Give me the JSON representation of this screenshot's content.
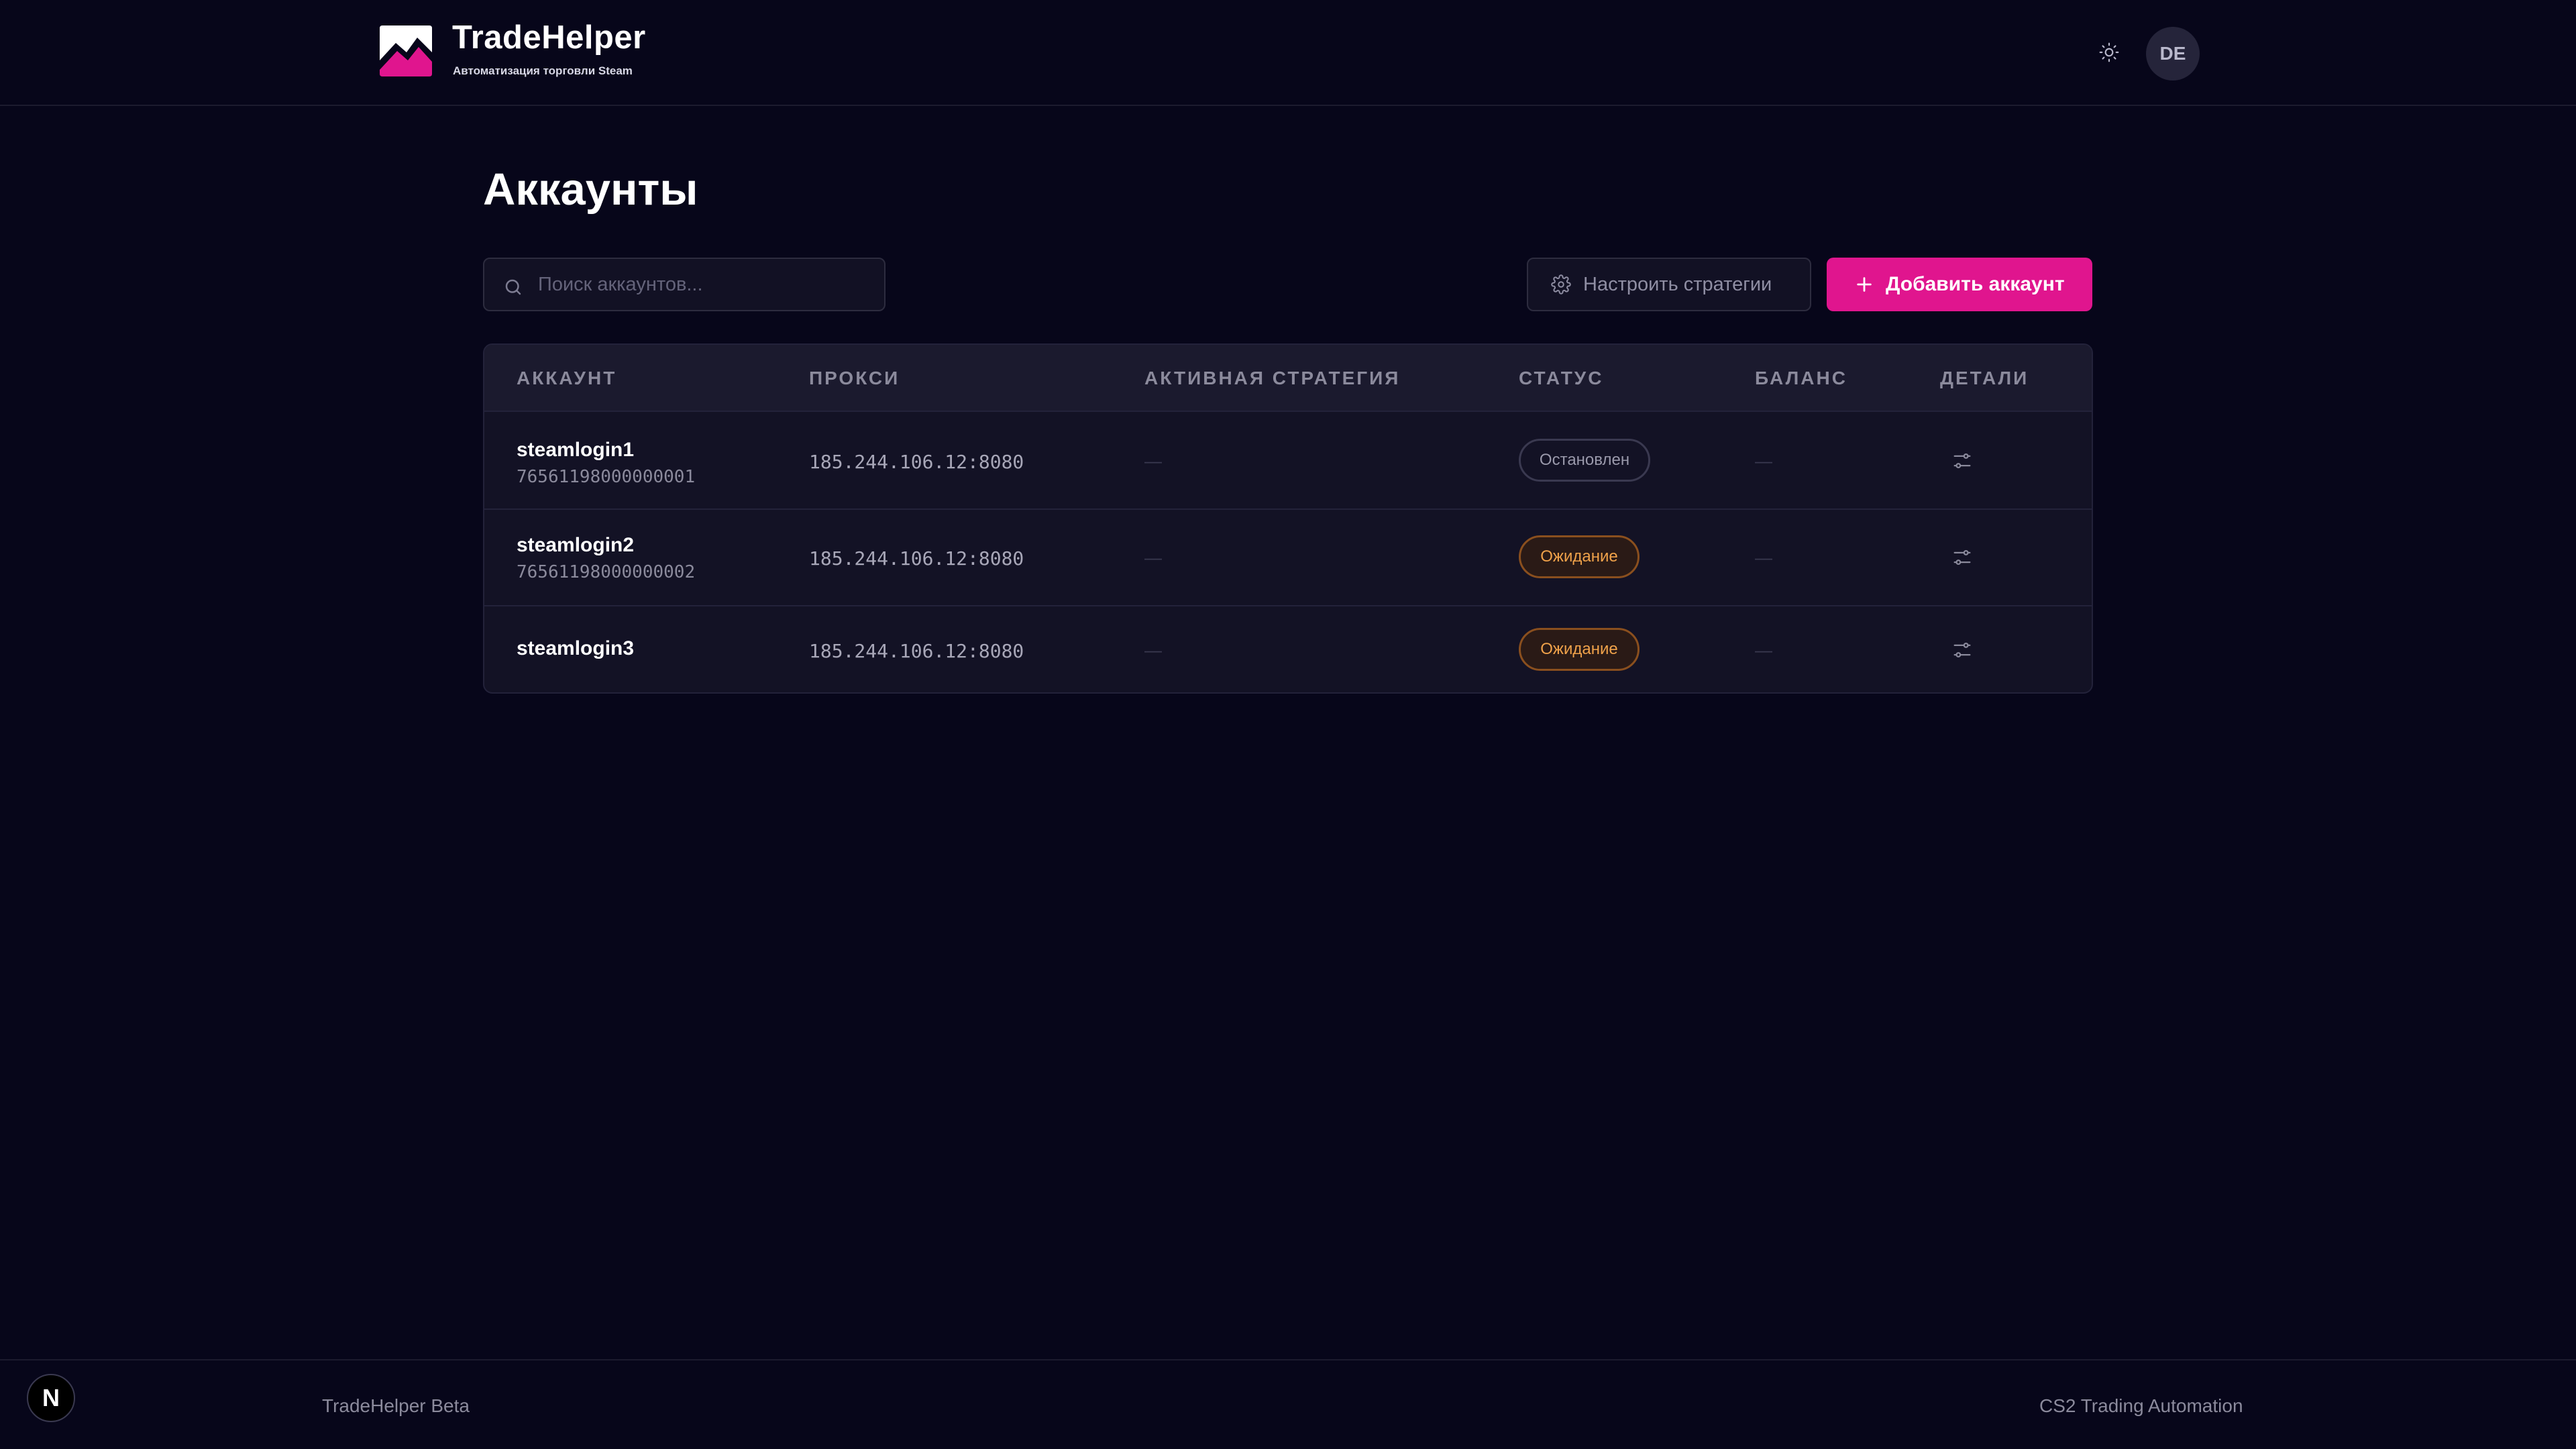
{
  "app": {
    "title": "TradeHelper",
    "subtitle": "Автоматизация торговли Steam",
    "avatar_initials": "DE",
    "accent_color": "#e0158e"
  },
  "main": {
    "page_title": "Аккаунты",
    "search": {
      "placeholder": "Поиск аккаунтов...",
      "value": ""
    },
    "strategies_button_label": "Настроить стратегии",
    "add_button_label": "Добавить аккаунт"
  },
  "table": {
    "columns": [
      "АККАУНТ",
      "ПРОКСИ",
      "АКТИВНАЯ СТРАТЕГИЯ",
      "СТАТУС",
      "БАЛАНС",
      "ДЕТАЛИ"
    ],
    "rows": [
      {
        "login": "steamlogin1",
        "steam_id": "76561198000000001",
        "proxy": "185.244.106.12:8080",
        "strategy": "—",
        "status": "Остановлен",
        "status_kind": "stopped",
        "balance": "—"
      },
      {
        "login": "steamlogin2",
        "steam_id": "76561198000000002",
        "proxy": "185.244.106.12:8080",
        "strategy": "—",
        "status": "Ожидание",
        "status_kind": "waiting",
        "balance": "—"
      },
      {
        "login": "steamlogin3",
        "steam_id": "",
        "proxy": "185.244.106.12:8080",
        "strategy": "—",
        "status": "Ожидание",
        "status_kind": "waiting",
        "balance": "—"
      }
    ]
  },
  "footer": {
    "left": "TradeHelper Beta",
    "right": "CS2 Trading Automation",
    "badge": "N"
  },
  "icons": {
    "theme": "sun-icon",
    "search": "search-icon",
    "strategies": "gear-icon",
    "add": "plus-icon",
    "details": "sliders-icon"
  }
}
